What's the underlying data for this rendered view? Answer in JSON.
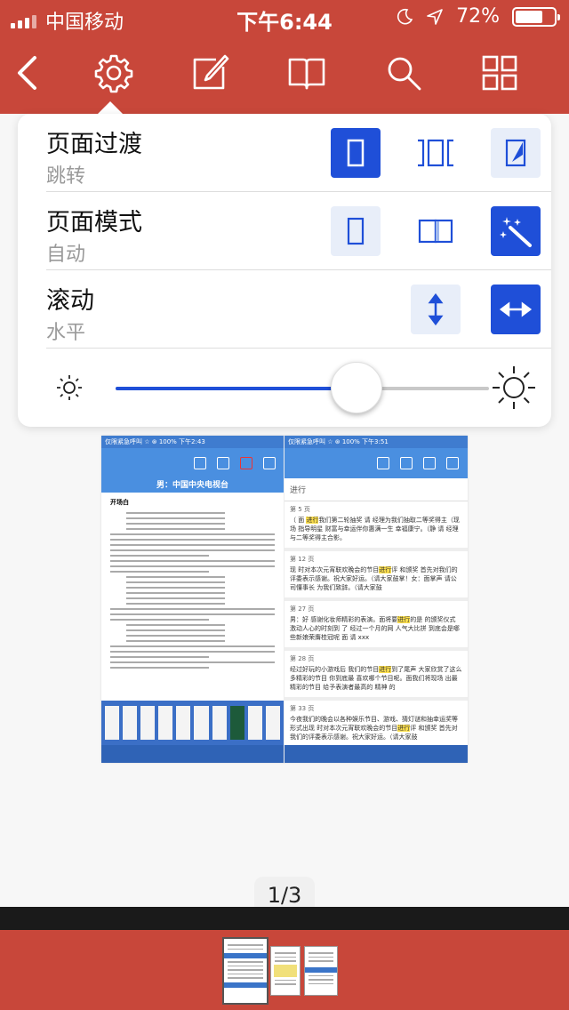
{
  "status_bar": {
    "carrier": "中国移动",
    "time": "下午6:44",
    "battery": "72%",
    "battery_level": 0.72
  },
  "toolbar": {
    "items": [
      {
        "icon": "back-icon"
      },
      {
        "icon": "gear-icon"
      },
      {
        "icon": "edit-icon"
      },
      {
        "icon": "book-icon"
      },
      {
        "icon": "search-icon"
      },
      {
        "icon": "grid-icon"
      }
    ]
  },
  "settings": {
    "transition": {
      "title": "页面过渡",
      "value": "跳转"
    },
    "page_mode": {
      "title": "页面模式",
      "value": "自动"
    },
    "scroll": {
      "title": "滚动",
      "value": "水平"
    },
    "brightness_level": 0.645
  },
  "document_preview": {
    "left": {
      "status": "仅限紧急呼叫 ☆    ⊛ 100%  下午2:43",
      "header": "男：中国中央电视台",
      "subheading": "开场白"
    },
    "right": {
      "status": "仅限紧急呼叫 ☆    ⊛ 100%  下午3:51",
      "search_term": "进行",
      "results": [
        {
          "page": "第 5 页",
          "before": "（ 面 ",
          "hit": "进行",
          "after": "我们第二轮抽奖 请 经理为我们抽取二等奖得主（现场 指导明星 财富与幸运伴你惠满一生 幸福康宁。（静 请 经理与二等奖得主合影。"
        },
        {
          "page": "第 12 页",
          "before": "现 时对本次元宵联欢晚会的节目",
          "hit": "进行",
          "after": "评 和颁奖 首先对我们的 评委表示感谢。祝大家好运。（请大家鼓掌！女：面掌声 请公司懂事长 为我们致辞。（请大家鼓"
        },
        {
          "page": "第 27 页",
          "before": "男：好 感谢化妆师精彩的表演。面将要",
          "hit": "进行",
          "after": "的是 的颁奖仪式 激动人心的时刻到 了 经过一个月的网 人气大比拼 到底会是哪些新娘荣膺桂冠呢 面 请 xxx"
        },
        {
          "page": "第 28 页",
          "before": "经过好玩的小游戏后 我们的节目",
          "hit": "进行",
          "after": "到了尾声 大家欣赏了这么多精彩的节目 你到底最 喜欢哪个节目呢。面我们将现场 出最精彩的节目 给予表演者最高的 精神 的"
        },
        {
          "page": "第 33 页",
          "before": "今夜我们的晚会以各种娱乐节目、游戏、猜灯谜和抽幸运奖等形式出现 时对本次元宵联欢晚会的节目",
          "hit": "进行",
          "after": "评 和颁奖 首先对我们的评委表示感谢。祝大家好运。（请大家鼓"
        }
      ]
    }
  },
  "page_indicator": "1/3"
}
